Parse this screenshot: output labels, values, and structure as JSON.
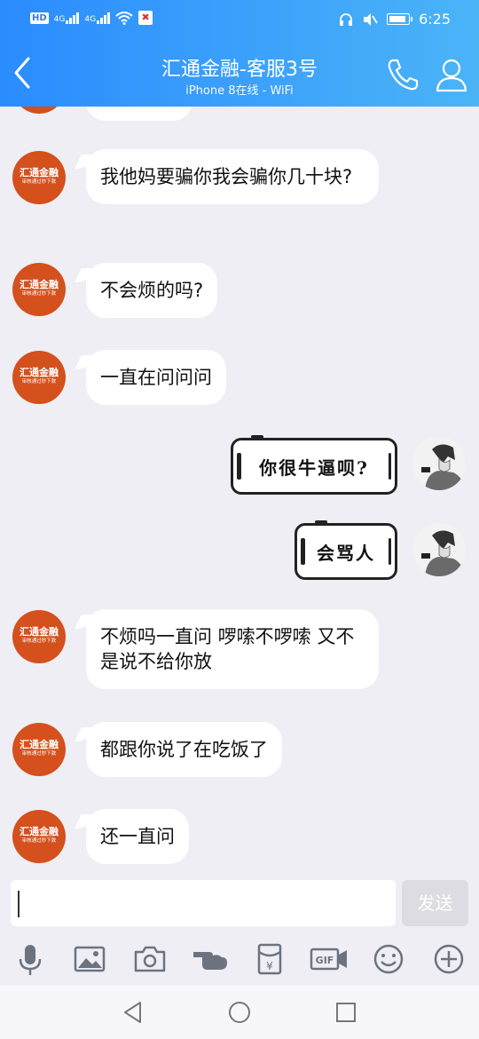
{
  "status": {
    "hd": "HD",
    "net1": "4G",
    "net2": "4G",
    "time": "6:25"
  },
  "header": {
    "title": "汇通金融-客服3号",
    "subtitle": "iPhone 8在线 - WiFi"
  },
  "contact_avatar": {
    "line1": "汇通金融",
    "line2": "审核通过秒下款"
  },
  "messages": [
    {
      "side": "left",
      "text": "我他妈要骗你我会骗你几十块?"
    },
    {
      "side": "left",
      "text": "不会烦的吗?"
    },
    {
      "side": "left",
      "text": "一直在问问问"
    },
    {
      "side": "right",
      "text": "你很牛逼呗?"
    },
    {
      "side": "right",
      "text": "会骂人"
    },
    {
      "side": "left",
      "text": "不烦吗一直问 啰嗦不啰嗦 又不是说不给你放"
    },
    {
      "side": "left",
      "text": "都跟你说了在吃饭了"
    },
    {
      "side": "left",
      "text": "还一直问"
    }
  ],
  "input": {
    "value": "",
    "send_label": "发送"
  },
  "toolbar_icons": [
    "mic-icon",
    "image-icon",
    "camera-icon",
    "poke-icon",
    "red-packet-icon",
    "gif-icon",
    "emoji-icon",
    "plus-icon"
  ],
  "colors": {
    "header_start": "#2a8cff",
    "header_end": "#4bb4f7",
    "avatar_bg": "#d4501c",
    "chat_bg": "#eeeef4"
  }
}
